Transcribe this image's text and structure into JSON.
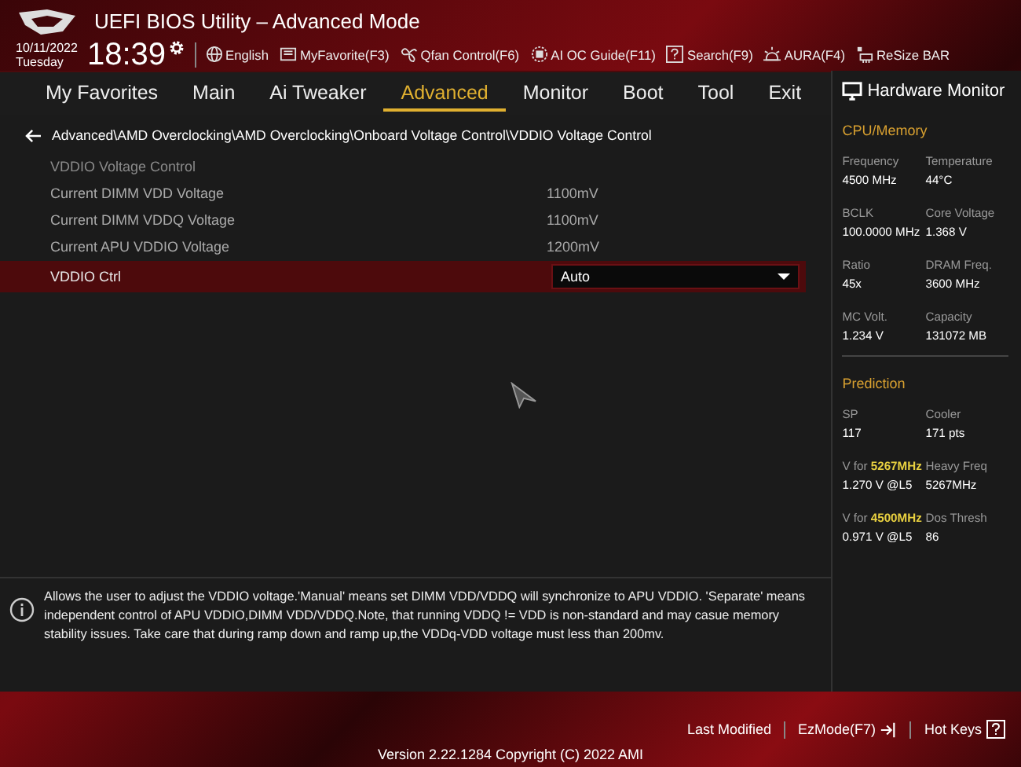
{
  "window": {
    "title": "UEFI BIOS Utility – Advanced Mode"
  },
  "clock": {
    "date": "10/11/2022",
    "day": "Tuesday",
    "time": "18:39"
  },
  "toolbar": [
    {
      "label": "English",
      "kind": "language"
    },
    {
      "label": "MyFavorite(F3)",
      "kind": "favorite"
    },
    {
      "label": "Qfan Control(F6)",
      "kind": "fan"
    },
    {
      "label": "AI OC Guide(F11)",
      "kind": "guide"
    },
    {
      "label": "Search(F9)",
      "kind": "search"
    },
    {
      "label": "AURA(F4)",
      "kind": "lighting"
    },
    {
      "label": "ReSize BAR",
      "kind": "resize"
    }
  ],
  "tabs": [
    {
      "label": "My Favorites",
      "selected": false
    },
    {
      "label": "Main",
      "selected": false
    },
    {
      "label": "Ai Tweaker",
      "selected": false
    },
    {
      "label": "Advanced",
      "selected": true
    },
    {
      "label": "Monitor",
      "selected": false
    },
    {
      "label": "Boot",
      "selected": false
    },
    {
      "label": "Tool",
      "selected": false
    },
    {
      "label": "Exit",
      "selected": false
    }
  ],
  "breadcrumb": "Advanced\\AMD Overclocking\\AMD Overclocking\\Onboard Voltage Control\\VDDIO Voltage Control",
  "settings": [
    {
      "kind": "heading",
      "label": "VDDIO Voltage Control",
      "selected": false
    },
    {
      "kind": "info",
      "label": "Current DIMM VDD Voltage",
      "value": "1100mV",
      "selected": false
    },
    {
      "kind": "info",
      "label": "Current DIMM VDDQ Voltage",
      "value": "1100mV",
      "selected": false
    },
    {
      "kind": "info",
      "label": "Current APU  VDDIO Voltage",
      "value": "1200mV",
      "selected": false
    },
    {
      "kind": "dropdown",
      "label": "VDDIO Ctrl",
      "value": "Auto",
      "selected": true
    }
  ],
  "help": "Allows the user to adjust the VDDIO voltage.'Manual' means set DIMM VDD/VDDQ will synchronize to APU VDDIO. 'Separate' means independent control of APU VDDIO,DIMM VDD/VDDQ.Note, that running VDDQ != VDD is non-standard and may casue memory stability issues. Take care that during ramp down and ramp up,the VDDq-VDD voltage must less than 200mv.",
  "hardware_monitor": {
    "title": "Hardware Monitor",
    "sections": [
      {
        "title": "CPU/Memory",
        "items": [
          {
            "label": "Frequency",
            "value": "4500 MHz"
          },
          {
            "label": "Temperature",
            "value": "44°C"
          },
          {
            "label": "BCLK",
            "value": "100.0000 MHz"
          },
          {
            "label": "Core Voltage",
            "value": "1.368 V"
          },
          {
            "label": "Ratio",
            "value": "45x"
          },
          {
            "label": "DRAM Freq.",
            "value": "3600 MHz"
          },
          {
            "label": "MC Volt.",
            "value": "1.234 V"
          },
          {
            "label": "Capacity",
            "value": "131072 MB"
          }
        ]
      },
      {
        "title": "Prediction",
        "items": [
          {
            "label": "SP",
            "value": "117"
          },
          {
            "label": "Cooler",
            "value": "171 pts"
          },
          {
            "label": "V for **5267MHz**",
            "value": "1.270 V @L5"
          },
          {
            "label": "Heavy Freq",
            "value": "5267MHz"
          },
          {
            "label": "V for **4500MHz**",
            "value": "0.971 V @L5"
          },
          {
            "label": "Dos Thresh",
            "value": "86"
          }
        ]
      }
    ]
  },
  "footer": {
    "last_modified": "Last Modified",
    "ez_mode": "EzMode(F7)",
    "hot_keys": "Hot Keys",
    "version": "Version 2.22.1284 Copyright (C) 2022 AMI"
  }
}
